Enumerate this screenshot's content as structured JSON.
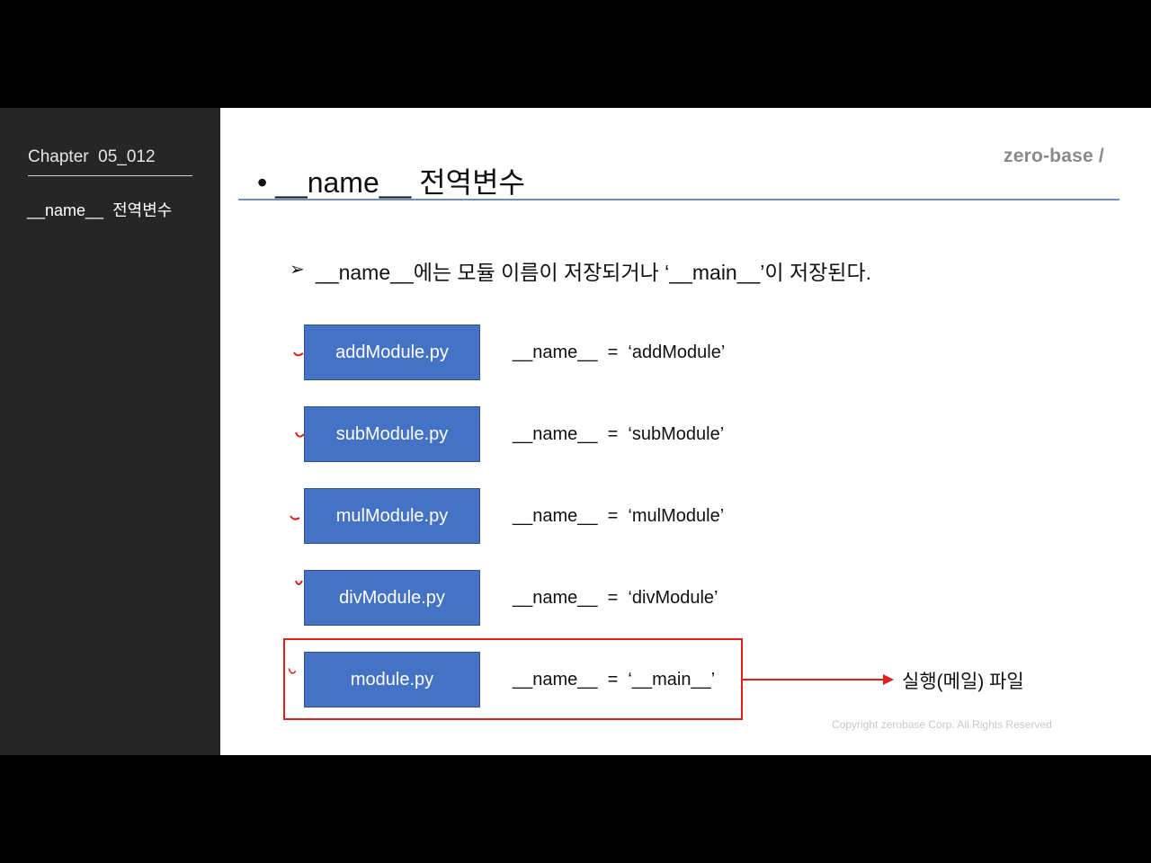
{
  "sidebar": {
    "chapter": "Chapter  05_012",
    "topic": "__name__  전역변수"
  },
  "slide": {
    "logo": "zero-base /",
    "title": "• __name__ 전역변수",
    "bullet_arrow": "➢",
    "bullet": "__name__에는 모듈 이름이 저장되거나 ‘__main__’이 저장된다.",
    "modules": [
      {
        "file": "addModule.py",
        "assign": "__name__  =  ‘addModule’"
      },
      {
        "file": "subModule.py",
        "assign": "__name__  =  ‘subModule’"
      },
      {
        "file": "mulModule.py",
        "assign": "__name__  =  ‘mulModule’"
      },
      {
        "file": "divModule.py",
        "assign": "__name__  =  ‘divModule’"
      },
      {
        "file": "module.py",
        "assign": "__name__  =  ‘__main__’"
      }
    ],
    "exec_label": "실행(메일) 파일",
    "copyright": "Copyright zerobase Corp. All Rights Reserved",
    "colors": {
      "box_fill": "#4472c4",
      "highlight": "#e0211b",
      "rule": "#6d8bc9"
    }
  }
}
